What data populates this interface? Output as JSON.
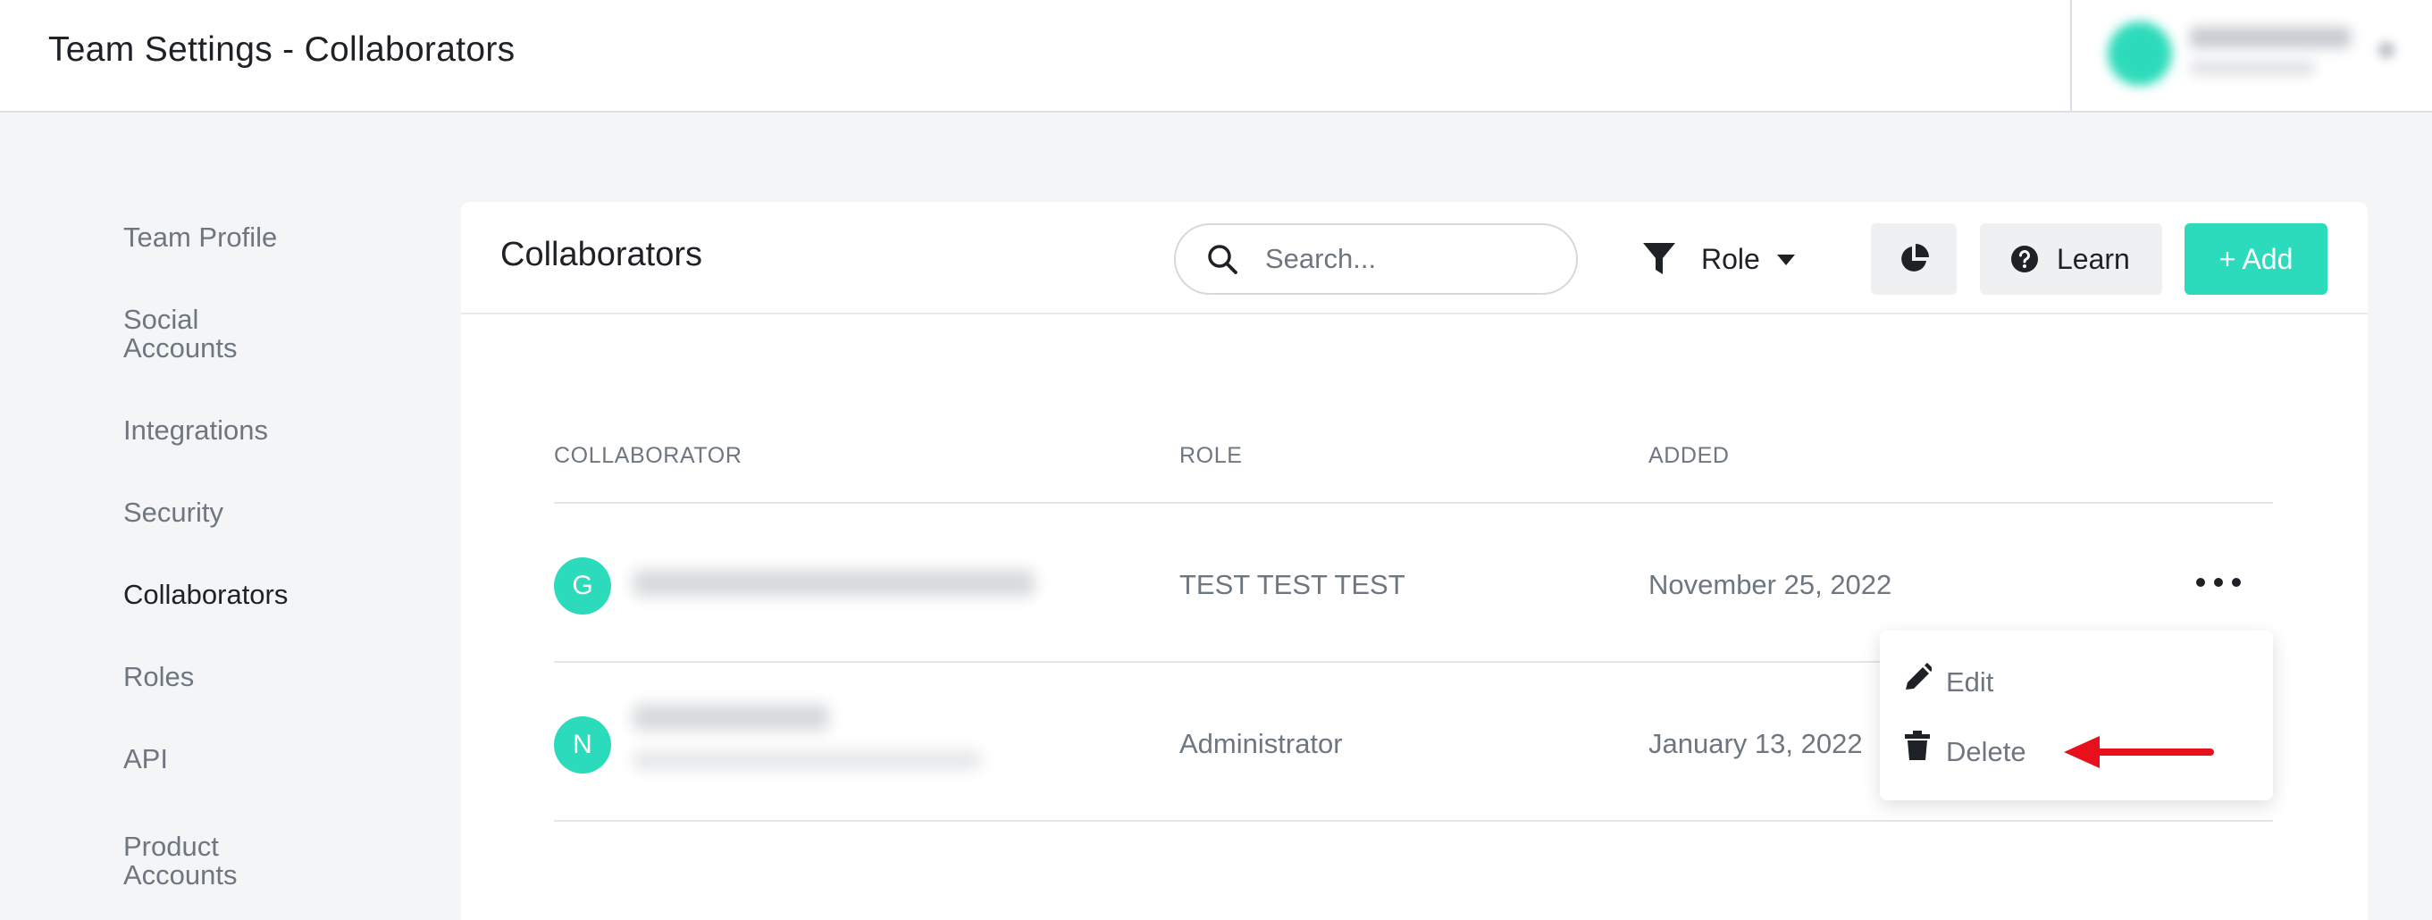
{
  "header": {
    "title": "Team Settings - Collaborators"
  },
  "sidebar": {
    "items": [
      {
        "label": "Team Profile",
        "active": false
      },
      {
        "label": "Social\nAccounts",
        "active": false
      },
      {
        "label": "Integrations",
        "active": false
      },
      {
        "label": "Security",
        "active": false
      },
      {
        "label": "Collaborators",
        "active": true
      },
      {
        "label": "Roles",
        "active": false
      },
      {
        "label": "API",
        "active": false
      },
      {
        "label": "Product\nAccounts",
        "active": false
      }
    ]
  },
  "main": {
    "title": "Collaborators",
    "search": {
      "placeholder": "Search...",
      "value": "",
      "icon": "search-icon"
    },
    "role_filter": {
      "label": "Role",
      "icon": "filter-icon"
    },
    "chart_button": {
      "icon": "pie-chart-icon"
    },
    "learn_button": {
      "label": "Learn",
      "icon": "help-circle-icon"
    },
    "add_button": {
      "label": "+ Add"
    },
    "table": {
      "columns": [
        "COLLABORATOR",
        "ROLE",
        "ADDED"
      ],
      "rows": [
        {
          "initial": "G",
          "role": "TEST TEST TEST",
          "added": "November 25, 2022"
        },
        {
          "initial": "N",
          "role": "Administrator",
          "added": "January 13, 2022"
        }
      ]
    },
    "row_menu": {
      "items": [
        {
          "label": "Edit",
          "icon": "pencil-icon"
        },
        {
          "label": "Delete",
          "icon": "trash-icon"
        }
      ]
    }
  },
  "colors": {
    "accent": "#2bdbbb",
    "annotation_arrow": "#e8101a",
    "muted_text": "#6e7680"
  }
}
